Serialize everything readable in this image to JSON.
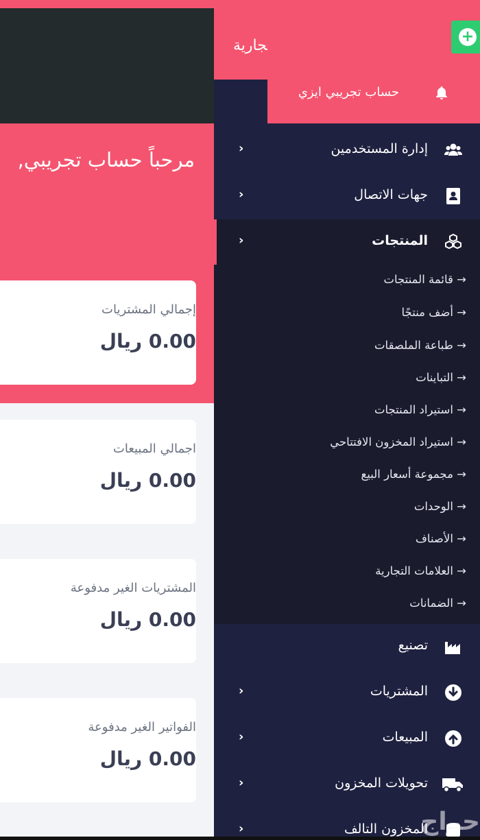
{
  "dashboard": {
    "welcome": "مرحباً حساب تجريبي,",
    "cards": [
      {
        "label": "إجمالي المشتريات",
        "value": "0.00 ريال"
      },
      {
        "label": "اجمالي المبيعات",
        "value": "0.00 ريال"
      },
      {
        "label": "المشتريات الغير مدفوعة",
        "value": "0.00 ريال"
      },
      {
        "label": "الفواتير الغير مدفوعة",
        "value": "0.00 ريال"
      }
    ]
  },
  "sidebar": {
    "brand_partial": "تجارية",
    "profile_name": "حساب تجريبي ايزي",
    "items": [
      {
        "label": "إدارة المستخدمين",
        "icon": "users-icon"
      },
      {
        "label": "جهات الاتصال",
        "icon": "address-book-icon"
      },
      {
        "label": "المنتجات",
        "icon": "cubes-icon"
      },
      {
        "label": "تصنيع",
        "icon": "industry-icon"
      },
      {
        "label": "المشتريات",
        "icon": "arrow-circle-down-icon"
      },
      {
        "label": "المبيعات",
        "icon": "arrow-circle-up-icon"
      },
      {
        "label": "تحويلات المخزون",
        "icon": "truck-icon"
      },
      {
        "label": "المخزون التالف",
        "icon": "database-icon"
      }
    ],
    "products_sub": [
      "→ قائمة المنتجات",
      "→ أضف منتجًا",
      "→ طباعة الملصقات",
      "→ التباينات",
      "→ استيراد المنتجات",
      "→ استيراد المخزون الافتتاحي",
      "→ مجموعة أسعار البيع",
      "→ الوحدات",
      "→ الأصناف",
      "→ العلامات التجارية",
      "→ الضمانات"
    ]
  },
  "watermark": "حراج",
  "colors": {
    "accent": "#f4546f",
    "sidebar": "#1f2140",
    "add": "#2ecc71"
  }
}
